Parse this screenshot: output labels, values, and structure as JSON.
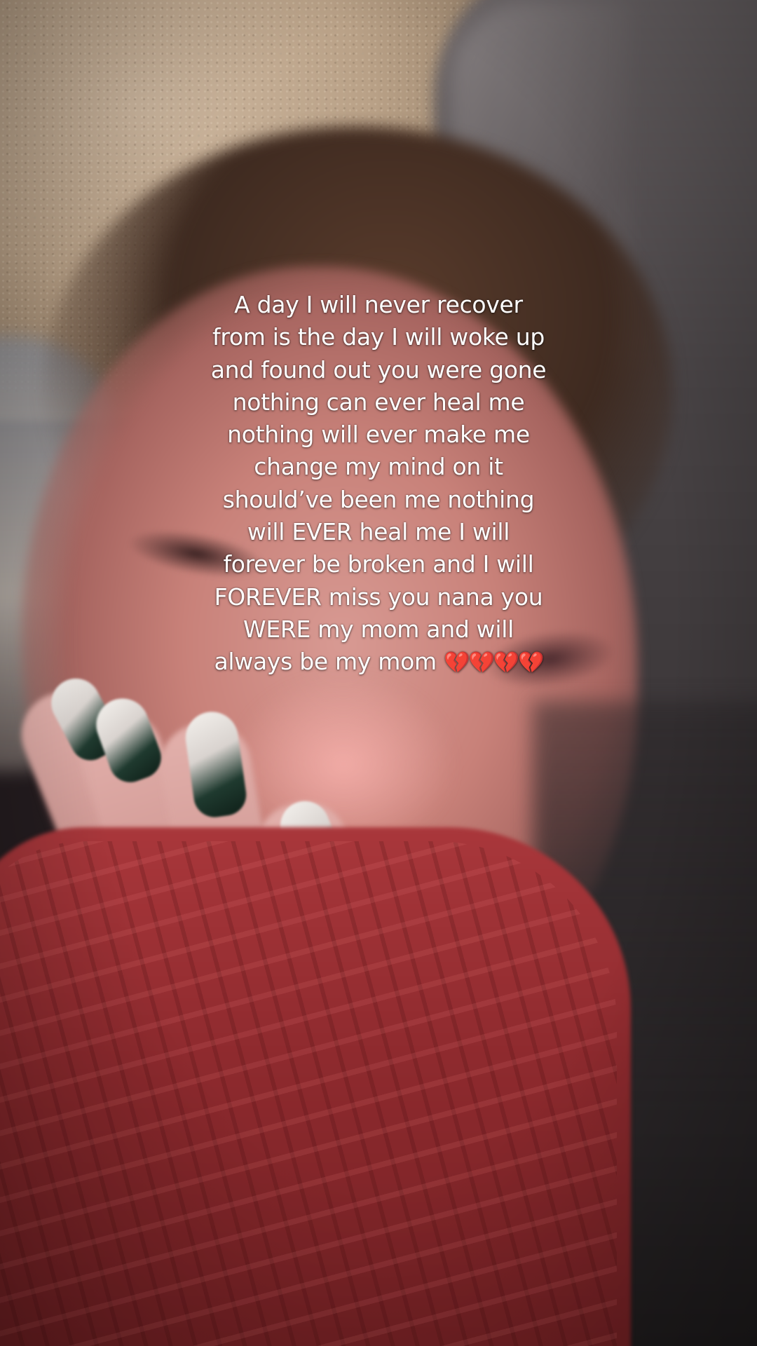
{
  "caption": {
    "lines": [
      "A day I will never recover",
      "from is the day I will woke up",
      "and found out you were gone",
      "nothing can ever heal me",
      "nothing will ever make me",
      "change my mind on it",
      "should’ve been me nothing",
      "will EVER heal me I will",
      "forever be broken and I will",
      "FOREVER miss you nana you",
      "WERE my mom and will",
      "always be my mom"
    ],
    "emoji": "💔💔💔💔"
  },
  "colors": {
    "caption_text": "#ffffff",
    "blanket": "#8e2a2e",
    "broken_heart": "#d6283d"
  }
}
